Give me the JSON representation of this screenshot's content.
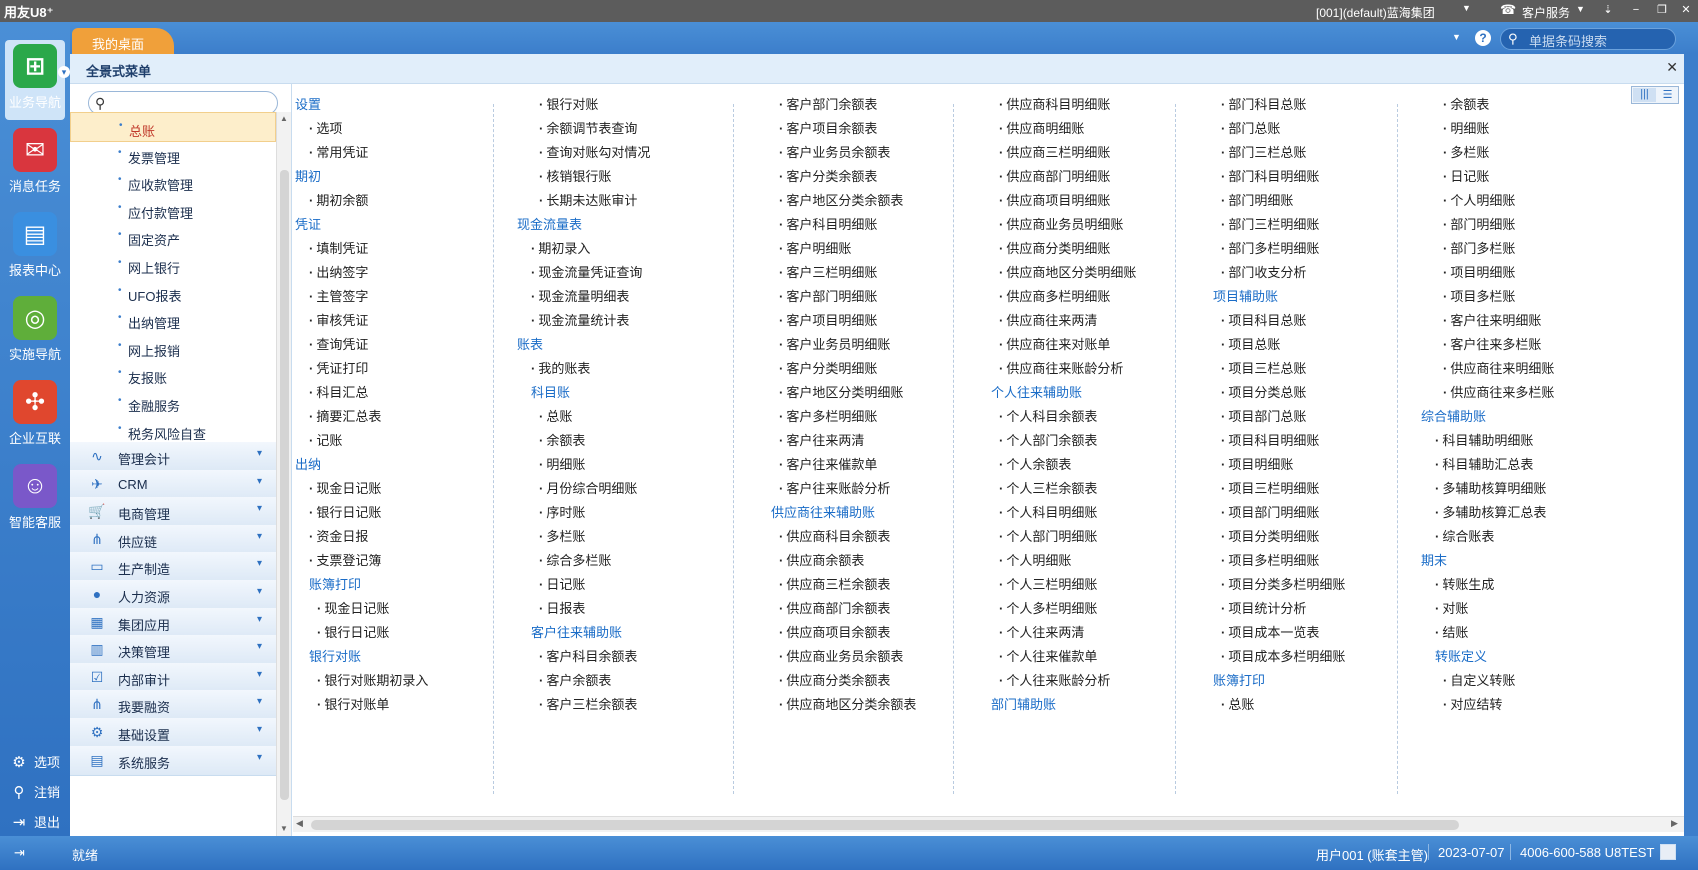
{
  "titlebar": {
    "logo": "用友U8⁺",
    "account": "[001](default)蓝海集团",
    "service": "客户服务"
  },
  "leftnav": {
    "items": [
      {
        "label": "业务导航",
        "icon": "business-nav-icon",
        "color": "#2aa84a"
      },
      {
        "label": "消息任务",
        "icon": "message-task-icon",
        "color": "#d9363e"
      },
      {
        "label": "报表中心",
        "icon": "report-center-icon",
        "color": "#3a8fe0"
      },
      {
        "label": "实施导航",
        "icon": "implement-nav-icon",
        "color": "#5fae3a"
      },
      {
        "label": "企业互联",
        "icon": "enterprise-link-icon",
        "color": "#e0472e"
      },
      {
        "label": "智能客服",
        "icon": "smart-service-icon",
        "color": "#7a58c9"
      }
    ],
    "bottom": [
      {
        "label": "选项",
        "icon": "gear-icon"
      },
      {
        "label": "注销",
        "icon": "logout-user-icon"
      },
      {
        "label": "退出",
        "icon": "exit-icon"
      }
    ]
  },
  "tabbar": {
    "home_tab": "我的桌面",
    "search_placeholder": "单据条码搜索"
  },
  "panel": {
    "title": "全景式菜单"
  },
  "sidebar": {
    "subitems": [
      "总账",
      "发票管理",
      "应收款管理",
      "应付款管理",
      "固定资产",
      "网上银行",
      "UFO报表",
      "出纳管理",
      "网上报销",
      "友报账",
      "金融服务",
      "税务风险自查"
    ],
    "selected_index": 0,
    "modules": [
      {
        "label": "管理会计",
        "icon": "chart-line-icon"
      },
      {
        "label": "CRM",
        "icon": "crm-handshake-icon"
      },
      {
        "label": "电商管理",
        "icon": "cart-icon"
      },
      {
        "label": "供应链",
        "icon": "network-icon"
      },
      {
        "label": "生产制造",
        "icon": "factory-icon"
      },
      {
        "label": "人力资源",
        "icon": "person-icon"
      },
      {
        "label": "集团应用",
        "icon": "grid-icon"
      },
      {
        "label": "决策管理",
        "icon": "chart-bar-icon"
      },
      {
        "label": "内部审计",
        "icon": "checklist-icon"
      },
      {
        "label": "我要融资",
        "icon": "finance-icon"
      },
      {
        "label": "基础设置",
        "icon": "settings-icon"
      },
      {
        "label": "系统服务",
        "icon": "service-icon"
      }
    ]
  },
  "menu": {
    "columns": [
      [
        {
          "t": "h",
          "text": "设置",
          "indent": 0
        },
        {
          "t": "i",
          "text": "选项",
          "indent": 1
        },
        {
          "t": "i",
          "text": "常用凭证",
          "indent": 1
        },
        {
          "t": "h",
          "text": "期初",
          "indent": 0
        },
        {
          "t": "i",
          "text": "期初余额",
          "indent": 1
        },
        {
          "t": "h",
          "text": "凭证",
          "indent": 0
        },
        {
          "t": "i",
          "text": "填制凭证",
          "indent": 1
        },
        {
          "t": "i",
          "text": "出纳签字",
          "indent": 1
        },
        {
          "t": "i",
          "text": "主管签字",
          "indent": 1
        },
        {
          "t": "i",
          "text": "审核凭证",
          "indent": 1
        },
        {
          "t": "i",
          "text": "查询凭证",
          "indent": 1
        },
        {
          "t": "i",
          "text": "凭证打印",
          "indent": 1
        },
        {
          "t": "i",
          "text": "科目汇总",
          "indent": 1
        },
        {
          "t": "i",
          "text": "摘要汇总表",
          "indent": 1
        },
        {
          "t": "i",
          "text": "记账",
          "indent": 1
        },
        {
          "t": "h",
          "text": "出纳",
          "indent": 0
        },
        {
          "t": "i",
          "text": "现金日记账",
          "indent": 1
        },
        {
          "t": "i",
          "text": "银行日记账",
          "indent": 1
        },
        {
          "t": "i",
          "text": "资金日报",
          "indent": 1
        },
        {
          "t": "i",
          "text": "支票登记簿",
          "indent": 1
        },
        {
          "t": "h",
          "text": "账簿打印",
          "indent": 1
        },
        {
          "t": "i",
          "text": "现金日记账",
          "indent": 2
        },
        {
          "t": "i",
          "text": "银行日记账",
          "indent": 2
        },
        {
          "t": "h",
          "text": "银行对账",
          "indent": 1
        },
        {
          "t": "i",
          "text": "银行对账期初录入",
          "indent": 2
        },
        {
          "t": "i",
          "text": "银行对账单",
          "indent": 2
        }
      ],
      [
        {
          "t": "i",
          "text": "银行对账",
          "indent": 2
        },
        {
          "t": "i",
          "text": "余额调节表查询",
          "indent": 2
        },
        {
          "t": "i",
          "text": "查询对账勾对情况",
          "indent": 2
        },
        {
          "t": "i",
          "text": "核销银行账",
          "indent": 2
        },
        {
          "t": "i",
          "text": "长期未达账审计",
          "indent": 2
        },
        {
          "t": "h",
          "text": "现金流量表",
          "indent": 0
        },
        {
          "t": "i",
          "text": "期初录入",
          "indent": 1
        },
        {
          "t": "i",
          "text": "现金流量凭证查询",
          "indent": 1
        },
        {
          "t": "i",
          "text": "现金流量明细表",
          "indent": 1
        },
        {
          "t": "i",
          "text": "现金流量统计表",
          "indent": 1
        },
        {
          "t": "h",
          "text": "账表",
          "indent": 0
        },
        {
          "t": "i",
          "text": "我的账表",
          "indent": 1
        },
        {
          "t": "h",
          "text": "科目账",
          "indent": 1
        },
        {
          "t": "i",
          "text": "总账",
          "indent": 2
        },
        {
          "t": "i",
          "text": "余额表",
          "indent": 2
        },
        {
          "t": "i",
          "text": "明细账",
          "indent": 2
        },
        {
          "t": "i",
          "text": "月份综合明细账",
          "indent": 2
        },
        {
          "t": "i",
          "text": "序时账",
          "indent": 2
        },
        {
          "t": "i",
          "text": "多栏账",
          "indent": 2
        },
        {
          "t": "i",
          "text": "综合多栏账",
          "indent": 2
        },
        {
          "t": "i",
          "text": "日记账",
          "indent": 2
        },
        {
          "t": "i",
          "text": "日报表",
          "indent": 2
        },
        {
          "t": "h",
          "text": "客户往来辅助账",
          "indent": 1
        },
        {
          "t": "i",
          "text": "客户科目余额表",
          "indent": 2
        },
        {
          "t": "i",
          "text": "客户余额表",
          "indent": 2
        },
        {
          "t": "i",
          "text": "客户三栏余额表",
          "indent": 2
        }
      ],
      [
        {
          "t": "i",
          "text": "客户部门余额表",
          "indent": 2
        },
        {
          "t": "i",
          "text": "客户项目余额表",
          "indent": 2
        },
        {
          "t": "i",
          "text": "客户业务员余额表",
          "indent": 2
        },
        {
          "t": "i",
          "text": "客户分类余额表",
          "indent": 2
        },
        {
          "t": "i",
          "text": "客户地区分类余额表",
          "indent": 2
        },
        {
          "t": "i",
          "text": "客户科目明细账",
          "indent": 2
        },
        {
          "t": "i",
          "text": "客户明细账",
          "indent": 2
        },
        {
          "t": "i",
          "text": "客户三栏明细账",
          "indent": 2
        },
        {
          "t": "i",
          "text": "客户部门明细账",
          "indent": 2
        },
        {
          "t": "i",
          "text": "客户项目明细账",
          "indent": 2
        },
        {
          "t": "i",
          "text": "客户业务员明细账",
          "indent": 2
        },
        {
          "t": "i",
          "text": "客户分类明细账",
          "indent": 2
        },
        {
          "t": "i",
          "text": "客户地区分类明细账",
          "indent": 2
        },
        {
          "t": "i",
          "text": "客户多栏明细账",
          "indent": 2
        },
        {
          "t": "i",
          "text": "客户往来两清",
          "indent": 2
        },
        {
          "t": "i",
          "text": "客户往来催款单",
          "indent": 2
        },
        {
          "t": "i",
          "text": "客户往来账龄分析",
          "indent": 2
        },
        {
          "t": "h",
          "text": "供应商往来辅助账",
          "indent": 1
        },
        {
          "t": "i",
          "text": "供应商科目余额表",
          "indent": 2
        },
        {
          "t": "i",
          "text": "供应商余额表",
          "indent": 2
        },
        {
          "t": "i",
          "text": "供应商三栏余额表",
          "indent": 2
        },
        {
          "t": "i",
          "text": "供应商部门余额表",
          "indent": 2
        },
        {
          "t": "i",
          "text": "供应商项目余额表",
          "indent": 2
        },
        {
          "t": "i",
          "text": "供应商业务员余额表",
          "indent": 2
        },
        {
          "t": "i",
          "text": "供应商分类余额表",
          "indent": 2
        },
        {
          "t": "i",
          "text": "供应商地区分类余额表",
          "indent": 2
        }
      ],
      [
        {
          "t": "i",
          "text": "供应商科目明细账",
          "indent": 2
        },
        {
          "t": "i",
          "text": "供应商明细账",
          "indent": 2
        },
        {
          "t": "i",
          "text": "供应商三栏明细账",
          "indent": 2
        },
        {
          "t": "i",
          "text": "供应商部门明细账",
          "indent": 2
        },
        {
          "t": "i",
          "text": "供应商项目明细账",
          "indent": 2
        },
        {
          "t": "i",
          "text": "供应商业务员明细账",
          "indent": 2
        },
        {
          "t": "i",
          "text": "供应商分类明细账",
          "indent": 2
        },
        {
          "t": "i",
          "text": "供应商地区分类明细账",
          "indent": 2
        },
        {
          "t": "i",
          "text": "供应商多栏明细账",
          "indent": 2
        },
        {
          "t": "i",
          "text": "供应商往来两清",
          "indent": 2
        },
        {
          "t": "i",
          "text": "供应商往来对账单",
          "indent": 2
        },
        {
          "t": "i",
          "text": "供应商往来账龄分析",
          "indent": 2
        },
        {
          "t": "h",
          "text": "个人往来辅助账",
          "indent": 1
        },
        {
          "t": "i",
          "text": "个人科目余额表",
          "indent": 2
        },
        {
          "t": "i",
          "text": "个人部门余额表",
          "indent": 2
        },
        {
          "t": "i",
          "text": "个人余额表",
          "indent": 2
        },
        {
          "t": "i",
          "text": "个人三栏余额表",
          "indent": 2
        },
        {
          "t": "i",
          "text": "个人科目明细账",
          "indent": 2
        },
        {
          "t": "i",
          "text": "个人部门明细账",
          "indent": 2
        },
        {
          "t": "i",
          "text": "个人明细账",
          "indent": 2
        },
        {
          "t": "i",
          "text": "个人三栏明细账",
          "indent": 2
        },
        {
          "t": "i",
          "text": "个人多栏明细账",
          "indent": 2
        },
        {
          "t": "i",
          "text": "个人往来两清",
          "indent": 2
        },
        {
          "t": "i",
          "text": "个人往来催款单",
          "indent": 2
        },
        {
          "t": "i",
          "text": "个人往来账龄分析",
          "indent": 2
        },
        {
          "t": "h",
          "text": "部门辅助账",
          "indent": 1
        }
      ],
      [
        {
          "t": "i",
          "text": "部门科目总账",
          "indent": 2
        },
        {
          "t": "i",
          "text": "部门总账",
          "indent": 2
        },
        {
          "t": "i",
          "text": "部门三栏总账",
          "indent": 2
        },
        {
          "t": "i",
          "text": "部门科目明细账",
          "indent": 2
        },
        {
          "t": "i",
          "text": "部门明细账",
          "indent": 2
        },
        {
          "t": "i",
          "text": "部门三栏明细账",
          "indent": 2
        },
        {
          "t": "i",
          "text": "部门多栏明细账",
          "indent": 2
        },
        {
          "t": "i",
          "text": "部门收支分析",
          "indent": 2
        },
        {
          "t": "h",
          "text": "项目辅助账",
          "indent": 1
        },
        {
          "t": "i",
          "text": "项目科目总账",
          "indent": 2
        },
        {
          "t": "i",
          "text": "项目总账",
          "indent": 2
        },
        {
          "t": "i",
          "text": "项目三栏总账",
          "indent": 2
        },
        {
          "t": "i",
          "text": "项目分类总账",
          "indent": 2
        },
        {
          "t": "i",
          "text": "项目部门总账",
          "indent": 2
        },
        {
          "t": "i",
          "text": "项目科目明细账",
          "indent": 2
        },
        {
          "t": "i",
          "text": "项目明细账",
          "indent": 2
        },
        {
          "t": "i",
          "text": "项目三栏明细账",
          "indent": 2
        },
        {
          "t": "i",
          "text": "项目部门明细账",
          "indent": 2
        },
        {
          "t": "i",
          "text": "项目分类明细账",
          "indent": 2
        },
        {
          "t": "i",
          "text": "项目多栏明细账",
          "indent": 2
        },
        {
          "t": "i",
          "text": "项目分类多栏明细账",
          "indent": 2
        },
        {
          "t": "i",
          "text": "项目统计分析",
          "indent": 2
        },
        {
          "t": "i",
          "text": "项目成本一览表",
          "indent": 2
        },
        {
          "t": "i",
          "text": "项目成本多栏明细账",
          "indent": 2
        },
        {
          "t": "h",
          "text": "账簿打印",
          "indent": 1
        },
        {
          "t": "i",
          "text": "总账",
          "indent": 2
        }
      ],
      [
        {
          "t": "i",
          "text": "余额表",
          "indent": 2
        },
        {
          "t": "i",
          "text": "明细账",
          "indent": 2
        },
        {
          "t": "i",
          "text": "多栏账",
          "indent": 2
        },
        {
          "t": "i",
          "text": "日记账",
          "indent": 2
        },
        {
          "t": "i",
          "text": "个人明细账",
          "indent": 2
        },
        {
          "t": "i",
          "text": "部门明细账",
          "indent": 2
        },
        {
          "t": "i",
          "text": "部门多栏账",
          "indent": 2
        },
        {
          "t": "i",
          "text": "项目明细账",
          "indent": 2
        },
        {
          "t": "i",
          "text": "项目多栏账",
          "indent": 2
        },
        {
          "t": "i",
          "text": "客户往来明细账",
          "indent": 2
        },
        {
          "t": "i",
          "text": "客户往来多栏账",
          "indent": 2
        },
        {
          "t": "i",
          "text": "供应商往来明细账",
          "indent": 2
        },
        {
          "t": "i",
          "text": "供应商往来多栏账",
          "indent": 2
        },
        {
          "t": "h",
          "text": "综合辅助账",
          "indent": 0
        },
        {
          "t": "i",
          "text": "科目辅助明细账",
          "indent": 1
        },
        {
          "t": "i",
          "text": "科目辅助汇总表",
          "indent": 1
        },
        {
          "t": "i",
          "text": "多辅助核算明细账",
          "indent": 1
        },
        {
          "t": "i",
          "text": "多辅助核算汇总表",
          "indent": 1
        },
        {
          "t": "i",
          "text": "综合账表",
          "indent": 1
        },
        {
          "t": "h",
          "text": "期末",
          "indent": 0
        },
        {
          "t": "i",
          "text": "转账生成",
          "indent": 1
        },
        {
          "t": "i",
          "text": "对账",
          "indent": 1
        },
        {
          "t": "i",
          "text": "结账",
          "indent": 1
        },
        {
          "t": "h",
          "text": "转账定义",
          "indent": 1
        },
        {
          "t": "i",
          "text": "自定义转账",
          "indent": 2
        },
        {
          "t": "i",
          "text": "对应结转",
          "indent": 2
        }
      ]
    ]
  },
  "statusbar": {
    "ready": "就绪",
    "user": "用户001 (账套主管)",
    "date": "2023-07-07",
    "phone": "4006-600-588 U8TEST"
  }
}
